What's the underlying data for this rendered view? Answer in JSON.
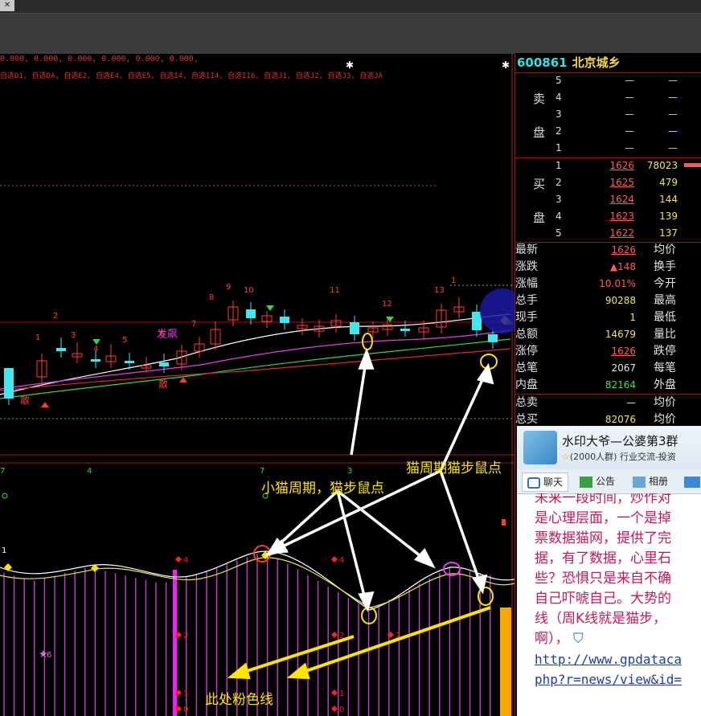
{
  "indicator": {
    "params": "0.000, 0.000, 0.000, 0.000, 0.000, 0.000,",
    "names": "自选D1, 自选DA, 自选E2, 自选E4, 自选E5, 自选I4, 自选II4, 自选II6, 自选J1, 自选J2, 自选J3, 自选JA"
  },
  "stock": {
    "code": "600861",
    "name": "北京城乡"
  },
  "orderbook": {
    "sell_label_1": "卖",
    "sell_label_2": "盘",
    "buy_label_1": "买",
    "buy_label_2": "盘",
    "sell": [
      {
        "level": "5",
        "price": "—",
        "volume": "—"
      },
      {
        "level": "4",
        "price": "—",
        "volume": "—"
      },
      {
        "level": "3",
        "price": "—",
        "volume": "—"
      },
      {
        "level": "2",
        "price": "—",
        "volume": "—"
      },
      {
        "level": "1",
        "price": "—",
        "volume": "—"
      }
    ],
    "buy": [
      {
        "level": "1",
        "price": "1626",
        "volume": "78023"
      },
      {
        "level": "2",
        "price": "1625",
        "volume": "479"
      },
      {
        "level": "3",
        "price": "1624",
        "volume": "144"
      },
      {
        "level": "4",
        "price": "1623",
        "volume": "139"
      },
      {
        "level": "5",
        "price": "1622",
        "volume": "137"
      }
    ]
  },
  "quote": [
    {
      "k": "最新",
      "v": "1626",
      "c": "#ff5a5a",
      "k2": "均价"
    },
    {
      "k": "涨跌",
      "v": "▲148",
      "c": "#ff5a5a",
      "k2": "换手"
    },
    {
      "k": "涨幅",
      "v": "10.01%",
      "c": "#ff5a5a",
      "k2": "今开"
    },
    {
      "k": "总手",
      "v": "90288",
      "c": "#f2e44b",
      "k2": "最高"
    },
    {
      "k": "现手",
      "v": "1",
      "c": "#f2e44b",
      "k2": "最低"
    },
    {
      "k": "总额",
      "v": "14679",
      "c": "#f2e44b",
      "k2": "量比"
    },
    {
      "k": "涨停",
      "v": "1626",
      "c": "#ff5a5a",
      "k2": "跌停"
    },
    {
      "k": "总笔",
      "v": "2067",
      "c": "#e2e2e2",
      "k2": "每笔"
    },
    {
      "k": "内盘",
      "v": "82164",
      "c": "#45e045",
      "k2": "外盘"
    },
    {
      "k": "总卖",
      "v": "—",
      "c": "#e2e2e2",
      "k2": "均价"
    },
    {
      "k": "总买",
      "v": "82076",
      "c": "#f2e44b",
      "k2": "均价"
    }
  ],
  "chat": {
    "group_name": "水印大爷—公婆第3群",
    "group_sub": "(2000人群) 行业交流-投资",
    "tabs": [
      "聊天",
      "公告",
      "相册"
    ],
    "lines": [
      "未来一段时间，炒作对",
      "是心理层面，一个是掉",
      "票数据猫网，提供了完",
      "据，有了数据，心里石",
      "些？恐惧只是来自不确",
      "自己吓唬自己。大势的",
      "线（周K线就是猫步，",
      "啊），"
    ],
    "link_1": "http://www.gpdataca",
    "link_2": "php?r=news/view&id="
  },
  "annotations": {
    "cat_cycle_step": "猫周期猫步鼠点",
    "kitten_cycle": "小猫周期，猫步鼠点",
    "pink_line": "此处粉色线"
  },
  "markers": {
    "buy_tag": "发飙",
    "sell_tag_1": "散",
    "sell_tag_2": "散",
    "upper_counts": [
      "1",
      "2",
      "3",
      "4",
      "5",
      "6",
      "7",
      "8",
      "9",
      "10",
      "11",
      "12",
      "13",
      "1"
    ],
    "lower_counts": [
      "7",
      "4",
      "7",
      "3"
    ],
    "red_labels": [
      "4",
      "4",
      "2",
      "2",
      "2",
      "1",
      "1",
      "0",
      "0"
    ],
    "star_label": "6",
    "first_lower": "1"
  },
  "colors": {
    "up": "#ff3a3a",
    "down": "#3ee8ee",
    "ma_white": "#ffffff",
    "ma_magenta": "#e040e0",
    "ma_green": "#3cd23c",
    "ma_red": "#d03030",
    "annotation": "#ffe400",
    "pink": "#ff1aff"
  }
}
